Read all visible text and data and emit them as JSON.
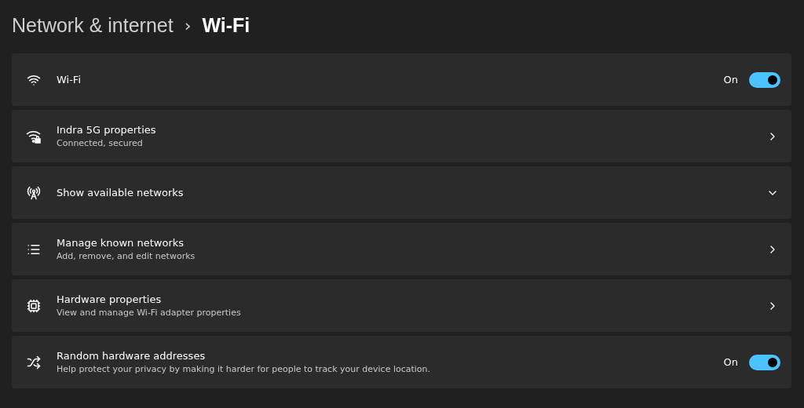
{
  "breadcrumb": {
    "parent": "Network & internet",
    "separator": "›",
    "current": "Wi-Fi"
  },
  "rows": [
    {
      "kind": "toggle",
      "title": "Wi-Fi",
      "state_label": "On",
      "on": true
    },
    {
      "kind": "link",
      "title": "Indra 5G properties",
      "subtitle": "Connected, secured"
    },
    {
      "kind": "expand",
      "title": "Show available networks",
      "expanded": false
    },
    {
      "kind": "link",
      "title": "Manage known networks",
      "subtitle": "Add, remove, and edit networks"
    },
    {
      "kind": "link",
      "title": "Hardware properties",
      "subtitle": "View and manage Wi-Fi adapter properties"
    },
    {
      "kind": "toggle",
      "title": "Random hardware addresses",
      "subtitle": "Help protect your privacy by making it harder for people to track your device location.",
      "state_label": "On",
      "on": true
    }
  ]
}
